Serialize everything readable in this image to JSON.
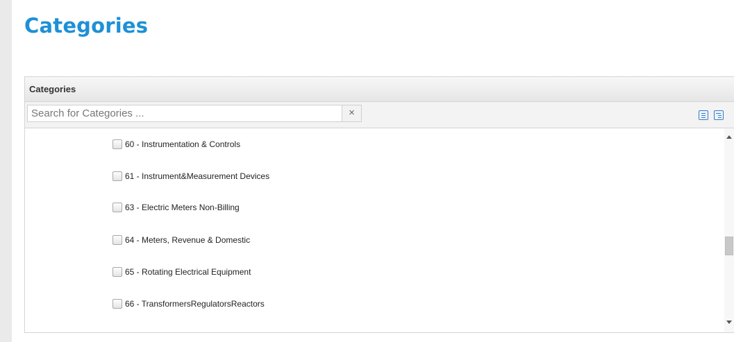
{
  "page": {
    "title": "Categories"
  },
  "panel": {
    "header": "Categories",
    "search": {
      "placeholder": "Search for Categories ...",
      "value": "",
      "clear_label": "×"
    },
    "toolbar_icons": [
      "list-view-icon",
      "tree-view-icon"
    ],
    "items": [
      {
        "label": "60 - Instrumentation & Controls",
        "checked": false
      },
      {
        "label": "61 - Instrument&Measurement Devices",
        "checked": false
      },
      {
        "label": "63 - Electric Meters Non-Billing",
        "checked": false
      },
      {
        "label": "64 - Meters, Revenue & Domestic",
        "checked": false
      },
      {
        "label": "65 - Rotating Electrical Equipment",
        "checked": false
      },
      {
        "label": "66 - TransformersRegulatorsReactors",
        "checked": false
      }
    ]
  },
  "colors": {
    "title": "#1e90d6",
    "icon": "#3a7bc8",
    "border": "#d4d4d4"
  }
}
